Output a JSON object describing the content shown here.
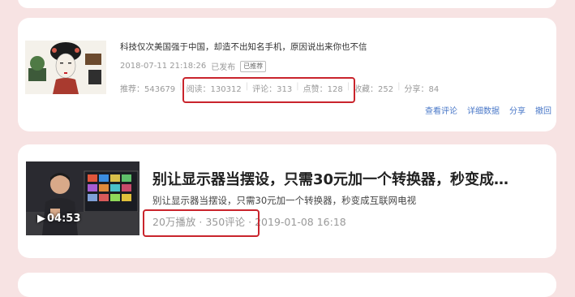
{
  "article": {
    "title": "科技仅次美国强于中国，却造不出知名手机，原因说出来你也不信",
    "datetime": "2018-07-11 21:18:26",
    "status": "已发布",
    "badge": "已推荐",
    "stats": {
      "recommend": "推荐：543679",
      "read": "阅读：130312",
      "comment": "评论：313",
      "like": "点赞：128",
      "favorite": "收藏：252",
      "share": "分享：84"
    },
    "actions": [
      "查看评论",
      "详细数据",
      "分享",
      "撤回"
    ]
  },
  "video": {
    "title": "别让显示器当摆设，只需30元加一个转换器，秒变成…",
    "subtitle": "别让显示器当摆设，只需30元加一个转换器，秒变成互联网电视",
    "duration": "04:53",
    "plays": "20万播放",
    "comments": "350评论",
    "datetime": "2019-01-08 16:18",
    "meta_sep": " · "
  },
  "colors": {
    "background": "#f7e3e3",
    "highlight": "#c9242c",
    "link": "#4a78c8"
  }
}
